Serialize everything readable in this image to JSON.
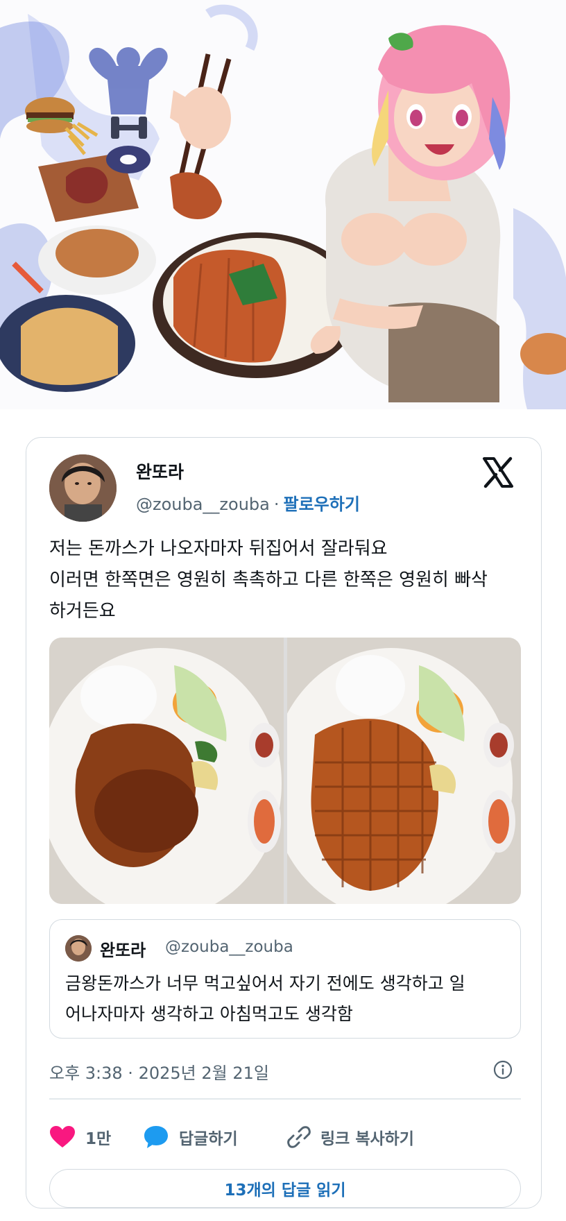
{
  "tweet": {
    "author_name": "완또라",
    "author_handle": "@zouba__zouba",
    "separator": "·",
    "follow_label": "팔로우하기",
    "text_lines": [
      "저는 돈까스가 나오자마자 뒤집어서 잘라둬요",
      "이러면 한쪽면은 영원히 촉촉하고 다른 한쪽은 영원히 빠삭",
      "하거든요"
    ],
    "quote": {
      "author_name": "완또라",
      "author_handle": "@zouba__zouba",
      "text_lines": [
        "금왕돈까스가 너무 먹고싶어서 자기 전에도 생각하고 일",
        "어나자마자 생각하고 아침먹고도 생각함"
      ]
    },
    "timestamp": "오후 3:38 · 2025년 2월 21일",
    "actions": {
      "like_count": "1만",
      "reply_label": "답글하기",
      "copy_link_label": "링크 복사하기"
    },
    "read_replies_label": "13개의 답글 읽기"
  },
  "icons": {
    "brand": "x-logo-icon",
    "info": "info-icon",
    "like": "heart-icon",
    "reply": "speech-bubble-icon",
    "copy_link": "link-icon"
  },
  "colors": {
    "like": "#f91880",
    "reply": "#1d9bf0",
    "link": "#1d6fb8",
    "secondary_text": "#536471",
    "border": "#d3dae0"
  }
}
